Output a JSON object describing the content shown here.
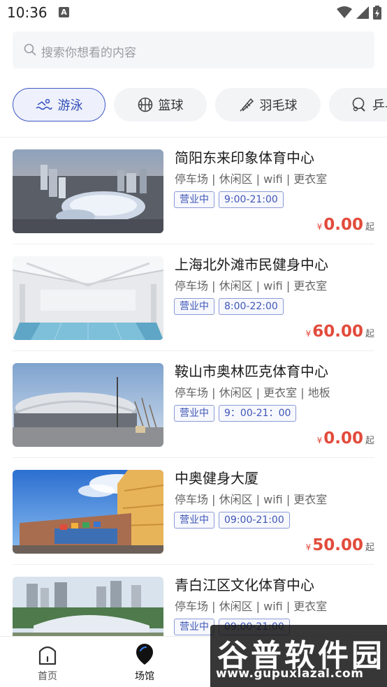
{
  "status_bar": {
    "time": "10:36",
    "notif_letter": "A"
  },
  "search": {
    "placeholder": "搜索你想看的内容"
  },
  "categories": [
    {
      "label": "游泳",
      "icon": "swim-icon",
      "active": true
    },
    {
      "label": "篮球",
      "icon": "basketball-icon",
      "active": false
    },
    {
      "label": "羽毛球",
      "icon": "shuttlecock-icon",
      "active": false
    },
    {
      "label": "乒乓球",
      "icon": "pingpong-icon",
      "active": false
    }
  ],
  "venues": [
    {
      "name": "简阳东来印象体育中心",
      "amenities": "停车场 | 休闲区 | wifi | 更衣室",
      "status": "营业中",
      "hours": "9:00-21:00",
      "currency": "¥",
      "price": "0.00",
      "price_suffix": "起"
    },
    {
      "name": "上海北外滩市民健身中心",
      "amenities": "停车场 | 休闲区 | wifi | 更衣室",
      "status": "营业中",
      "hours": "8:00-22:00",
      "currency": "¥",
      "price": "60.00",
      "price_suffix": "起"
    },
    {
      "name": "鞍山市奥林匹克体育中心",
      "amenities": "停车场 | 休闲区 | 更衣室 | 地板",
      "status": "营业中",
      "hours": "9：00-21：00",
      "currency": "¥",
      "price": "0.00",
      "price_suffix": "起"
    },
    {
      "name": "中奥健身大厦",
      "amenities": "停车场 | 休闲区 | wifi | 更衣室",
      "status": "营业中",
      "hours": "09:00-21:00",
      "currency": "¥",
      "price": "50.00",
      "price_suffix": "起"
    },
    {
      "name": "青白江区文化体育中心",
      "amenities": "停车场 | 休闲区 | wifi | 更衣室",
      "status": "营业中",
      "hours": "09:00-21:00",
      "currency": "¥",
      "price": "",
      "price_suffix": ""
    }
  ],
  "tabbar": [
    {
      "label": "首页",
      "icon": "home-icon",
      "active": false
    },
    {
      "label": "场馆",
      "icon": "venue-icon",
      "active": true
    }
  ],
  "watermark": {
    "title": "谷普软件园",
    "url": "www.gupuxlazal.com"
  },
  "colors": {
    "accent": "#3d57c4",
    "price": "#e24b3b",
    "search_bg": "#f5f6f8"
  }
}
